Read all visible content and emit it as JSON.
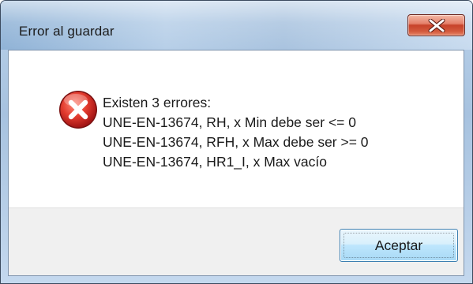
{
  "dialog": {
    "title": "Error al guardar",
    "close_icon": "close-icon",
    "error_icon": "error-icon",
    "message_lines": [
      "Existen 3 errores:",
      "UNE-EN-13674, RH, x Min debe ser <= 0",
      "UNE-EN-13674, RFH, x Max debe ser >= 0",
      "UNE-EN-13674, HR1_I, x Max vacío"
    ],
    "ok_label": "Aceptar"
  },
  "colors": {
    "titlebar": "#b9d1ea",
    "close_button": "#c7432b",
    "error_icon": "#d42b2b",
    "ok_button_border": "#3c7fb1",
    "footer": "#f0f0f0"
  }
}
